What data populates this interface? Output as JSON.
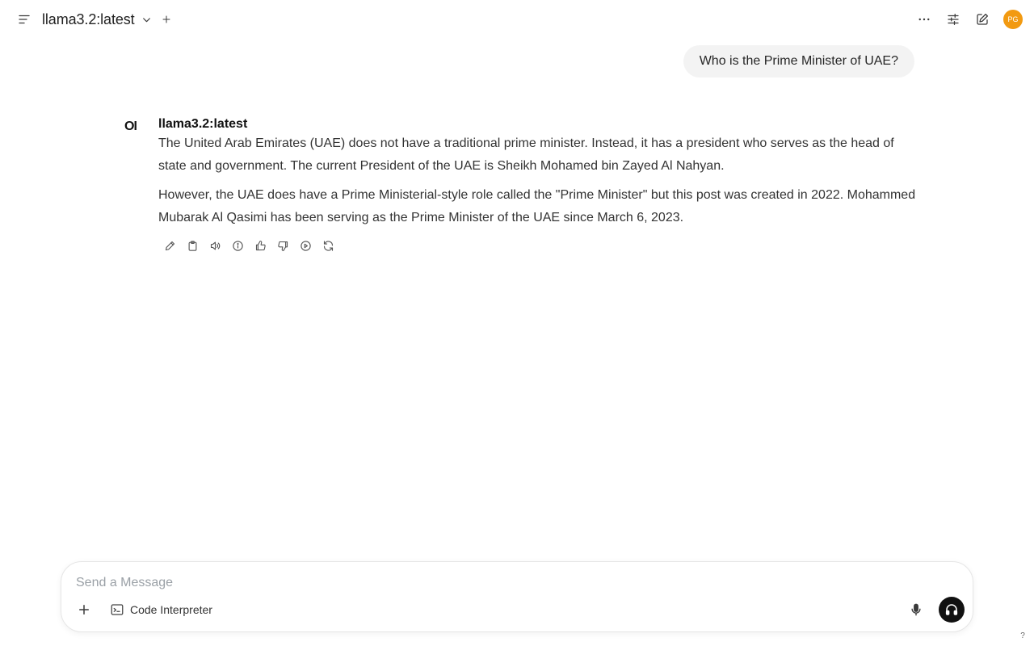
{
  "header": {
    "model_name": "llama3.2:latest",
    "avatar_initials": "PG",
    "avatar_color": "#f29a11"
  },
  "conversation": {
    "user_message": "Who is the Prime Minister of UAE?",
    "assistant": {
      "logo": "OI",
      "name": "llama3.2:latest",
      "paragraphs": [
        "The United Arab Emirates (UAE) does not have a traditional prime minister. Instead, it has a president who serves as the head of state and government. The current President of the UAE is Sheikh Mohamed bin Zayed Al Nahyan.",
        "However, the UAE does have a Prime Ministerial-style role called the \"Prime Minister\" but this post was created in 2022. Mohammed Mubarak Al Qasimi has been serving as the Prime Minister of the UAE since March 6, 2023."
      ],
      "actions": [
        "edit-icon",
        "copy-icon",
        "read-aloud-icon",
        "info-icon",
        "thumbs-up-icon",
        "thumbs-down-icon",
        "continue-icon",
        "regenerate-icon"
      ]
    }
  },
  "composer": {
    "placeholder": "Send a Message",
    "code_interpreter_label": "Code Interpreter"
  },
  "help_label": "?"
}
